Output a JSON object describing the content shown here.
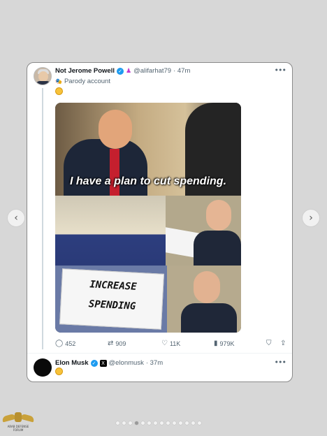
{
  "carousel": {
    "prev_icon": "chevron-left-icon",
    "next_icon": "chevron-right-icon",
    "dots_count": 14,
    "active_dot": 3
  },
  "tweet1": {
    "name": "Not Jerome Powell",
    "handle": "@alifarhat79",
    "time": "· 47m",
    "parody_label": "Parody account",
    "emoji": "🤣",
    "meme": {
      "caption": "I have a plan to cut spending.",
      "sign_line1": "INCREASE",
      "sign_line2": "SPENDING"
    },
    "stats": {
      "replies": "452",
      "retweets": "909",
      "likes": "11K",
      "views": "979K"
    }
  },
  "tweet2": {
    "name": "Elon Musk",
    "handle": "@elonmusk",
    "time": "· 37m",
    "emoji": "🤣"
  },
  "colors": {
    "verified": "#1d9bf0",
    "muted": "#536471",
    "background": "#d7d7d7"
  },
  "watermark": {
    "text": "ARAB DEFENSE FORUM"
  }
}
